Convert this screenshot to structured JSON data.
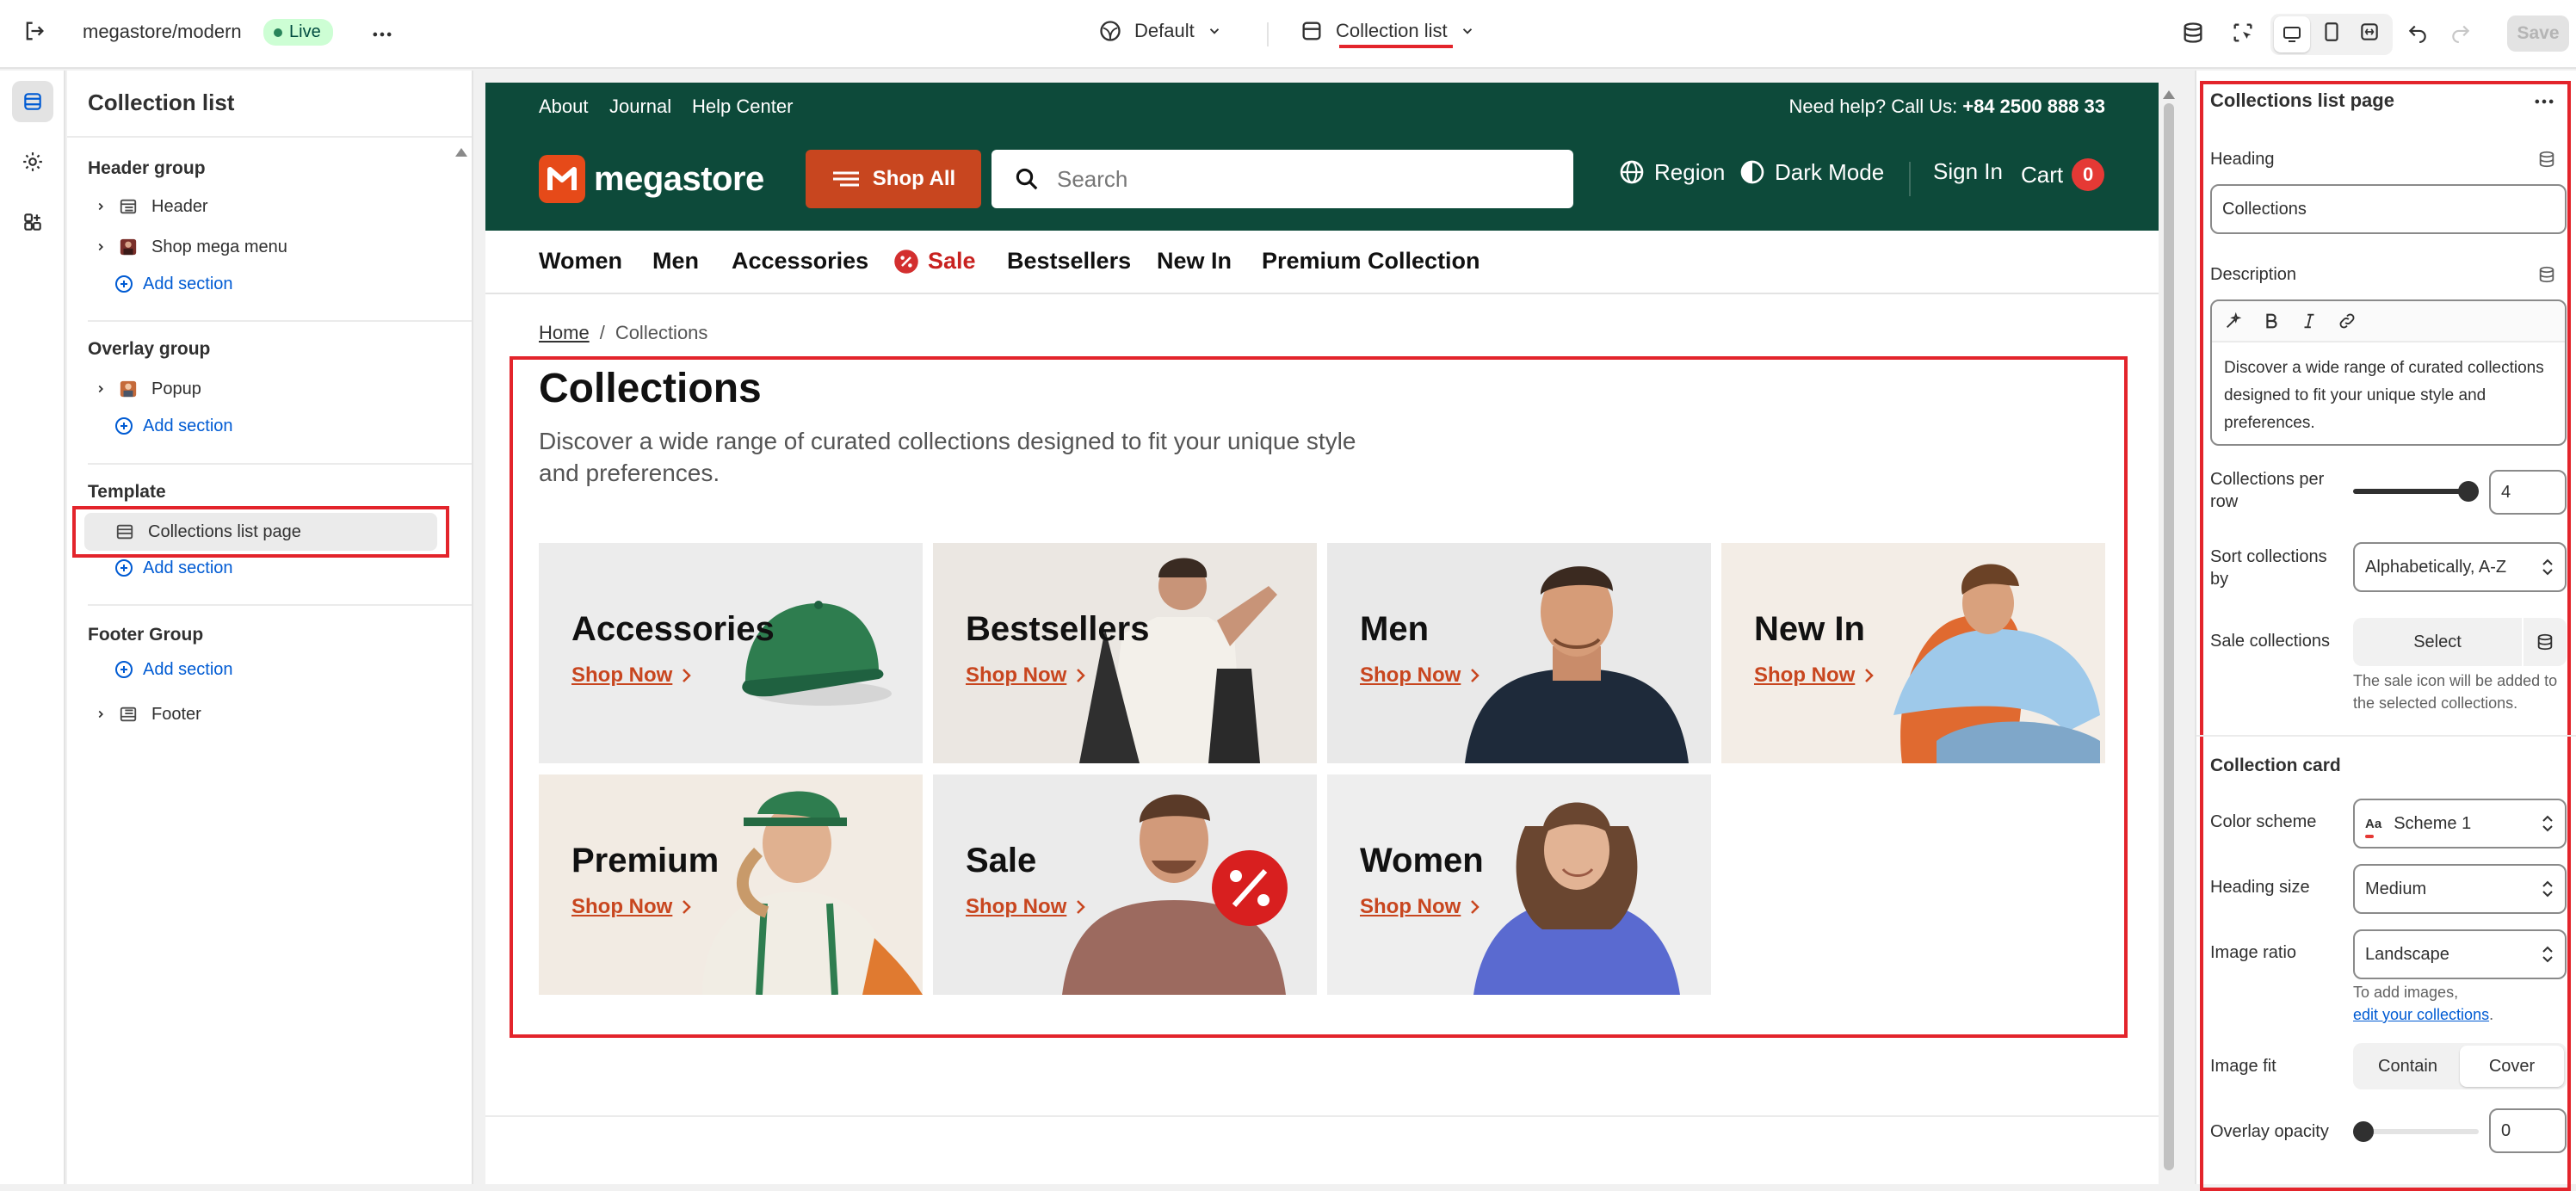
{
  "topbar": {
    "store_name": "megastore/modern",
    "status": "Live",
    "theme_selector": "Default",
    "template_selector": "Collection list",
    "save_label": "Save"
  },
  "left_panel": {
    "title": "Collection list",
    "header_group": {
      "heading": "Header group",
      "items": [
        "Header",
        "Shop mega menu"
      ],
      "add_label": "Add section"
    },
    "overlay_group": {
      "heading": "Overlay group",
      "items": [
        "Popup"
      ],
      "add_label": "Add section"
    },
    "template": {
      "heading": "Template",
      "items": [
        "Collections list page"
      ],
      "add_label": "Add section"
    },
    "footer_group": {
      "heading": "Footer Group",
      "add_label": "Add section",
      "items": [
        "Footer"
      ]
    }
  },
  "storefront": {
    "announcement_links": [
      "About",
      "Journal",
      "Help Center"
    ],
    "help_text": "Need help? Call Us:",
    "phone": "+84 2500 888 33",
    "logo": "megastore",
    "shop_all": "Shop All",
    "search_placeholder": "Search",
    "region": "Region",
    "dark_mode": "Dark Mode",
    "sign_in": "Sign In",
    "cart": "Cart",
    "cart_count": "0",
    "nav": [
      "Women",
      "Men",
      "Accessories",
      "Sale",
      "Bestsellers",
      "New In",
      "Premium Collection"
    ],
    "breadcrumb_home": "Home",
    "breadcrumb_sep": "/",
    "breadcrumb_current": "Collections",
    "heading": "Collections",
    "description": "Discover a wide range of curated collections designed to fit your unique style and preferences.",
    "collections": [
      {
        "title": "Accessories",
        "cta": "Shop Now"
      },
      {
        "title": "Bestsellers",
        "cta": "Shop Now"
      },
      {
        "title": "Men",
        "cta": "Shop Now"
      },
      {
        "title": "New In",
        "cta": "Shop Now"
      },
      {
        "title": "Premium",
        "cta": "Shop Now"
      },
      {
        "title": "Sale",
        "cta": "Shop Now"
      },
      {
        "title": "Women",
        "cta": "Shop Now"
      }
    ]
  },
  "right_panel": {
    "title": "Collections list page",
    "heading_label": "Heading",
    "heading_value": "Collections",
    "description_label": "Description",
    "description_value": "Discover a wide range of curated collections designed to fit your unique style and preferences.",
    "per_row_label": "Collections per row",
    "per_row_value": "4",
    "per_row_fraction": 1.0,
    "sort_label": "Sort collections by",
    "sort_value": "Alphabetically, A-Z",
    "sale_label": "Sale collections",
    "sale_button": "Select",
    "sale_hint": "The sale icon will be added to the selected collections.",
    "card_heading": "Collection card",
    "color_scheme_label": "Color scheme",
    "color_scheme_value": "Scheme 1",
    "color_scheme_icon": "Aa",
    "heading_size_label": "Heading size",
    "heading_size_value": "Medium",
    "image_ratio_label": "Image ratio",
    "image_ratio_value": "Landscape",
    "image_hint": "To add images,",
    "image_hint_link": "edit your collections",
    "image_hint_end": ".",
    "image_fit_label": "Image fit",
    "image_fit_options": [
      "Contain",
      "Cover"
    ],
    "image_fit_selected": "Cover",
    "overlay_label": "Overlay opacity",
    "overlay_value": "0",
    "overlay_fraction": 0.0
  },
  "colors": {
    "brand_green": "#0d4a3a",
    "accent_orange": "#c8461f",
    "highlight_red": "#e3242b",
    "link_blue": "#005bd3"
  }
}
